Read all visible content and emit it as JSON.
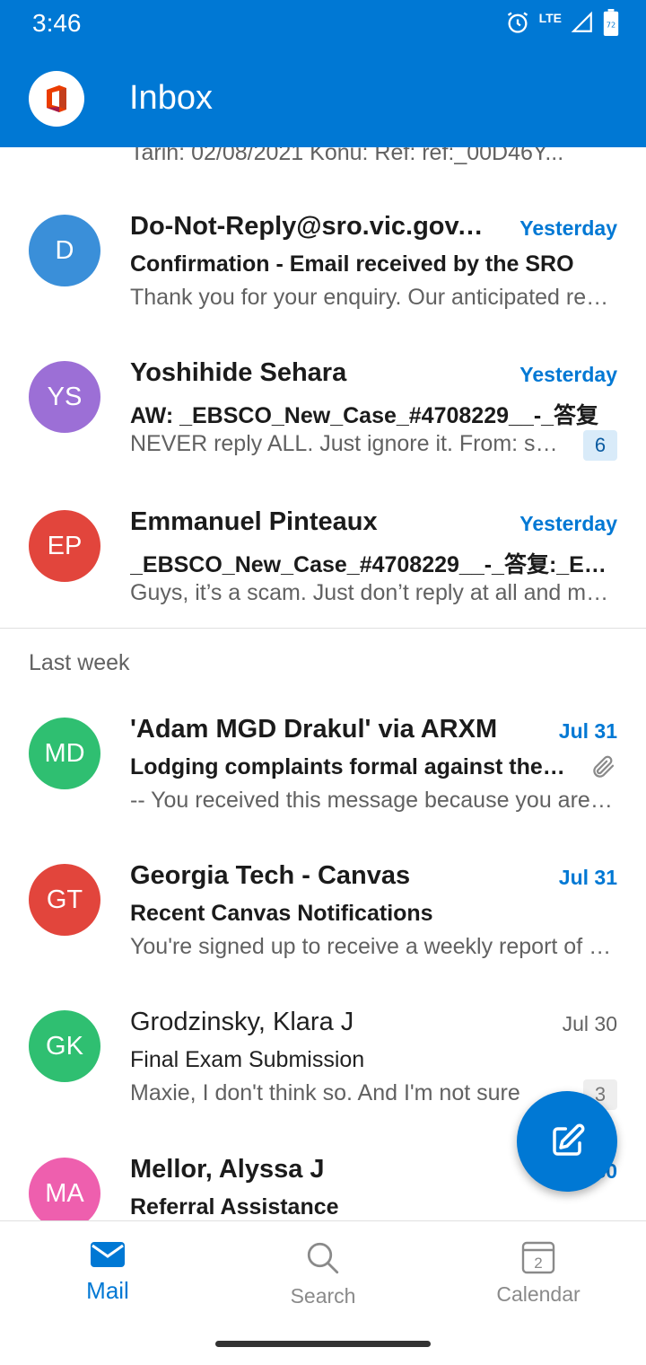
{
  "status_bar": {
    "time": "3:46",
    "network": "LTE",
    "battery": "72"
  },
  "header": {
    "title": "Inbox"
  },
  "top_partial_preview": "Tarih: 02/08/2021 Konu: Ref: ref:_00D46Y...",
  "messages": [
    {
      "initials": "D",
      "avatar_color": "#3a8fd9",
      "sender": "Do-Not-Reply@sro.vic.gov.au",
      "date": "Yesterday",
      "subject": "Confirmation - Email received by the SRO",
      "preview": "Thank you for your enquiry. Our anticipated response time is",
      "unread": true
    },
    {
      "initials": "YS",
      "avatar_color": "#9c6fd6",
      "sender": "Yoshihide Sehara",
      "date": "Yesterday",
      "subject": "AW: _EBSCO_New_Case_#4708229__-_答复",
      "preview": "NEVER reply ALL. Just ignore it. From: someone",
      "count": "6",
      "unread": true
    },
    {
      "initials": "EP",
      "avatar_color": "#e2453c",
      "sender": "Emmanuel Pinteaux",
      "date": "Yesterday",
      "subject": "_EBSCO_New_Case_#4708229__-_答复:_EBSCO",
      "preview": "Guys, it’s a scam. Just don’t reply at all and move on",
      "unread": true
    },
    {
      "initials": "MD",
      "avatar_color": "#2fbf71",
      "sender": "'Adam MGD Drakul' via ARXM",
      "date": "Jul 31",
      "subject": "Lodging complaints formal against the group",
      "preview": "-- You received this message because you are subscribed",
      "has_attachment": true,
      "unread": true
    },
    {
      "initials": "GT",
      "avatar_color": "#e2453c",
      "sender": "Georgia Tech - Canvas",
      "date": "Jul 31",
      "subject": "Recent Canvas Notifications",
      "preview": "You're signed up to receive a weekly report of activity",
      "unread": true
    },
    {
      "initials": "GK",
      "avatar_color": "#2fbf71",
      "sender": "Grodzinsky, Klara J",
      "date": "Jul 30",
      "subject": "Final Exam Submission",
      "preview": "Maxie, I don't think so. And I'm not sure",
      "count": "3",
      "unread": false
    },
    {
      "initials": "MA",
      "avatar_color": "#ee5fae",
      "sender": "Mellor, Alyssa J",
      "date": "Jul 30",
      "subject": "Referral Assistance",
      "preview": "",
      "unread": true
    }
  ],
  "section_last_week": "Last week",
  "nav": {
    "mail": "Mail",
    "search": "Search",
    "calendar": "Calendar",
    "calendar_day": "2"
  },
  "colors": {
    "brand": "#0078d4"
  }
}
